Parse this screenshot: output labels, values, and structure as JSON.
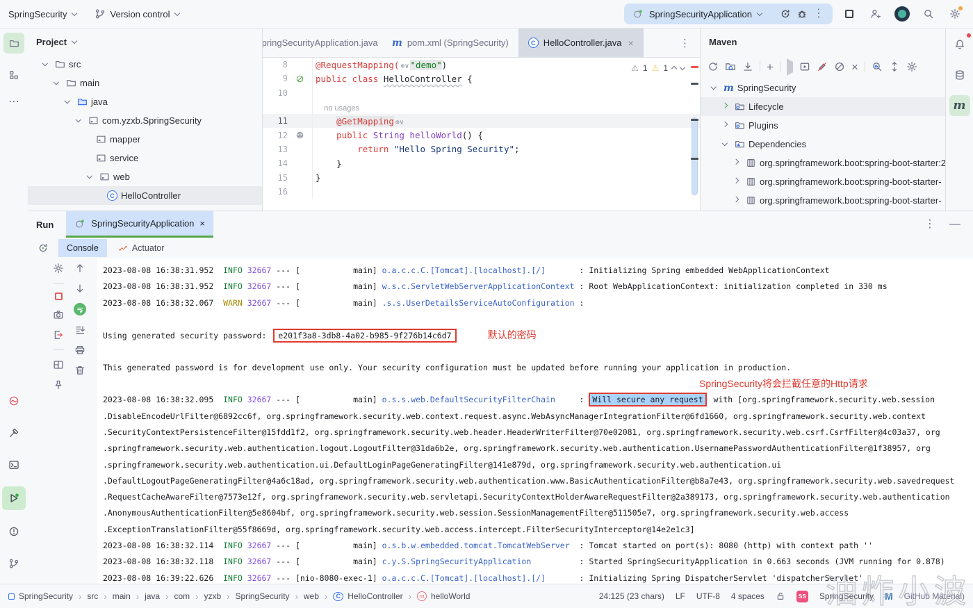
{
  "colors": {
    "accent_blue": "#3574f0",
    "run_green": "#57a64a",
    "selection_blue": "#cfe1fb",
    "annotation_red": "#e03b30",
    "info_green": "#168039",
    "warn_yellow": "#a68a00",
    "pid_purple": "#8250df",
    "logger_blue": "#3a63c8",
    "keyword_red": "#d5413e",
    "string_navy": "#17377a",
    "string_green": "#0b801a",
    "type_purple": "#8440c8",
    "active_tool_green": "#d5ebd8",
    "badge_pink": "#ee4f7d"
  },
  "topbar": {
    "project_name": "SpringSecurity",
    "version_control": "Version control",
    "run_config": "SpringSecurityApplication"
  },
  "project_panel": {
    "title": "Project",
    "tree": [
      {
        "label": "src",
        "depth": 0,
        "chev": "down",
        "icon": "folder-icon"
      },
      {
        "label": "main",
        "depth": 1,
        "chev": "down",
        "icon": "folder-icon"
      },
      {
        "label": "java",
        "depth": 2,
        "chev": "down",
        "icon": "folder-blue-icon"
      },
      {
        "label": "com.yzxb.SpringSecurity",
        "depth": 3,
        "chev": "down",
        "icon": "package-icon"
      },
      {
        "label": "mapper",
        "depth": 4,
        "chev": "none",
        "icon": "package-icon"
      },
      {
        "label": "service",
        "depth": 4,
        "chev": "none",
        "icon": "package-icon"
      },
      {
        "label": "web",
        "depth": 4,
        "chev": "down",
        "icon": "package-icon"
      },
      {
        "label": "HelloController",
        "depth": 5,
        "chev": "none",
        "icon": "class-icon",
        "selected": true
      }
    ]
  },
  "editor": {
    "tabs": [
      {
        "label": "SpringSecurityApplication.java",
        "icon": null,
        "clipped": true,
        "active": false
      },
      {
        "label": "pom.xml (SpringSecurity)",
        "icon": "maven-icon",
        "active": false
      },
      {
        "label": "HelloController.java",
        "icon": "class-icon",
        "active": true,
        "close": true
      }
    ],
    "inspections": {
      "errors": "1",
      "warnings": "1"
    },
    "inlay_hint": "no usages",
    "code": [
      {
        "num": "8",
        "tokens": [
          [
            "@RequestMapping(",
            "ann"
          ],
          [
            "INLAY"
          ],
          [
            "\"demo\"",
            "strg"
          ],
          [
            ")",
            "pln"
          ]
        ]
      },
      {
        "num": "9",
        "gutter": "run-class-icon",
        "tokens": [
          [
            "public class ",
            "kw"
          ],
          [
            "HelloController",
            "cls"
          ],
          [
            " {",
            "pln"
          ]
        ]
      },
      {
        "num": "10",
        "tokens": []
      },
      {
        "inlay": "no usages"
      },
      {
        "num": "11",
        "cur": true,
        "tokens": [
          [
            "    ",
            "pln"
          ],
          [
            "@GetMapping",
            "ann hl"
          ],
          [
            "INLAY"
          ]
        ]
      },
      {
        "num": "12",
        "gutter": "endpoint-icon",
        "tokens": [
          [
            "    ",
            "pln"
          ],
          [
            "public ",
            "kw"
          ],
          [
            "String ",
            "typ"
          ],
          [
            "helloWorld",
            "mtd"
          ],
          [
            "() {",
            "pln"
          ]
        ]
      },
      {
        "num": "13",
        "tokens": [
          [
            "        ",
            "pln"
          ],
          [
            "return ",
            "kw"
          ],
          [
            "\"Hello Spring Security\"",
            "str"
          ],
          [
            ";",
            "pln"
          ]
        ]
      },
      {
        "num": "14",
        "tokens": [
          [
            "    }",
            "pln"
          ]
        ]
      },
      {
        "num": "15",
        "tokens": [
          [
            "}",
            "pln"
          ]
        ]
      },
      {
        "num": "16",
        "tokens": []
      }
    ]
  },
  "maven": {
    "title": "Maven",
    "tree": [
      {
        "label": "SpringSecurity",
        "depth": 0,
        "chev": "down",
        "icon": "maven-icon"
      },
      {
        "label": "Lifecycle",
        "depth": 1,
        "chev": "right-green",
        "icon": "folder-gear-icon",
        "hover": true
      },
      {
        "label": "Plugins",
        "depth": 1,
        "chev": "right",
        "icon": "folder-gear-icon"
      },
      {
        "label": "Dependencies",
        "depth": 1,
        "chev": "down",
        "icon": "folder-lib-icon"
      },
      {
        "label": "org.springframework.boot:spring-boot-starter:2",
        "depth": 2,
        "chev": "right",
        "icon": "jar-icon"
      },
      {
        "label": "org.springframework.boot:spring-boot-starter-",
        "depth": 2,
        "chev": "right",
        "icon": "jar-icon"
      },
      {
        "label": "org.springframework.boot:spring-boot-starter-",
        "depth": 2,
        "chev": "right",
        "icon": "jar-icon"
      }
    ]
  },
  "run_panel": {
    "label": "Run",
    "tab": "SpringSecurityApplication",
    "tabs": [
      {
        "label": "Console",
        "selected": true
      },
      {
        "label": "Actuator",
        "selected": false
      }
    ],
    "console": [
      {
        "type": "log",
        "time": "2023-08-08 16:38:31.952",
        "level": "INFO",
        "pid": "32667",
        "thread": "main",
        "logger": "o.a.c.c.C.[Tomcat].[localhost].[/]",
        "msg": "Initializing Spring embedded WebApplicationContext"
      },
      {
        "type": "log",
        "time": "2023-08-08 16:38:31.952",
        "level": "INFO",
        "pid": "32667",
        "thread": "main",
        "logger": "w.s.c.ServletWebServerApplicationContext",
        "msg": "Root WebApplicationContext: initialization completed in 330 ms"
      },
      {
        "type": "log",
        "time": "2023-08-08 16:38:32.067",
        "level": "WARN",
        "pid": "32667",
        "thread": "main",
        "logger": ".s.s.UserDetailsServiceAutoConfiguration",
        "msg": ""
      },
      {
        "type": "blank"
      },
      {
        "type": "password",
        "prefix": "Using generated security password: ",
        "value": "e201f3a8-3db8-4a02-b985-9f276b14c6d7"
      },
      {
        "type": "blank"
      },
      {
        "type": "text",
        "text": "This generated password is for development use only. Your security configuration must be updated before running your application in production."
      },
      {
        "type": "annotation"
      },
      {
        "type": "secure",
        "time": "2023-08-08 16:38:32.095",
        "level": "INFO",
        "pid": "32667",
        "thread": "main",
        "logger": "o.s.s.web.DefaultSecurityFilterChain",
        "boxed": "Will secure any request",
        "after": " with [org.springframework.security.web.session"
      },
      {
        "type": "cont",
        "text": ".DisableEncodeUrlFilter@6892cc6f, org.springframework.security.web.context.request.async.WebAsyncManagerIntegrationFilter@6fd1660, org.springframework.security.web.context"
      },
      {
        "type": "cont",
        "text": ".SecurityContextPersistenceFilter@15fdd1f2, org.springframework.security.web.header.HeaderWriterFilter@70e02081, org.springframework.security.web.csrf.CsrfFilter@4c03a37, org"
      },
      {
        "type": "cont",
        "text": ".springframework.security.web.authentication.logout.LogoutFilter@31da6b2e, org.springframework.security.web.authentication.UsernamePasswordAuthenticationFilter@1f38957, org"
      },
      {
        "type": "cont",
        "text": ".springframework.security.web.authentication.ui.DefaultLoginPageGeneratingFilter@141e879d, org.springframework.security.web.authentication.ui"
      },
      {
        "type": "cont",
        "text": ".DefaultLogoutPageGeneratingFilter@4a6c18ad, org.springframework.security.web.authentication.www.BasicAuthenticationFilter@b8a7e43, org.springframework.security.web.savedrequest"
      },
      {
        "type": "cont",
        "text": ".RequestCacheAwareFilter@7573e12f, org.springframework.security.web.servletapi.SecurityContextHolderAwareRequestFilter@2a389173, org.springframework.security.web.authentication"
      },
      {
        "type": "cont",
        "text": ".AnonymousAuthenticationFilter@5e8604bf, org.springframework.security.web.session.SessionManagementFilter@511505e7, org.springframework.security.web.access"
      },
      {
        "type": "cont",
        "text": ".ExceptionTranslationFilter@55f8669d, org.springframework.security.web.access.intercept.FilterSecurityInterceptor@14e2e1c3]"
      },
      {
        "type": "log",
        "time": "2023-08-08 16:38:32.114",
        "level": "INFO",
        "pid": "32667",
        "thread": "main",
        "logger": "o.s.b.w.embedded.tomcat.TomcatWebServer",
        "msg": "Tomcat started on port(s): 8080 (http) with context path ''"
      },
      {
        "type": "log",
        "time": "2023-08-08 16:38:32.118",
        "level": "INFO",
        "pid": "32667",
        "thread": "main",
        "logger": "c.y.S.SpringSecurityApplication",
        "msg": "Started SpringSecurityApplication in 0.663 seconds (JVM running for 0.878)"
      },
      {
        "type": "log",
        "time": "2023-08-08 16:39:22.626",
        "level": "INFO",
        "pid": "32667",
        "thread": "nio-8080-exec-1",
        "logger": "o.a.c.c.C.[Tomcat].[localhost].[/]",
        "msg": "Initializing Spring DispatcherServlet 'dispatcherServlet'"
      }
    ]
  },
  "annotations": {
    "password_note": "默认的密码",
    "secure_note": "SpringSecurity将会拦截任意的Http请求"
  },
  "statusbar": {
    "breadcrumbs": [
      {
        "label": "SpringSecurity",
        "icon": "project-icon"
      },
      {
        "label": "src"
      },
      {
        "label": "main"
      },
      {
        "label": "java"
      },
      {
        "label": "com"
      },
      {
        "label": "yzxb"
      },
      {
        "label": "SpringSecurity"
      },
      {
        "label": "web"
      },
      {
        "label": "HelloController",
        "icon": "class-icon"
      },
      {
        "label": "helloWorld",
        "icon": "method-icon"
      }
    ],
    "right_items": [
      "24:125 (23 chars)",
      "LF",
      "UTF-8",
      "4 spaces"
    ],
    "badge": "SS",
    "project": "SpringSecurity",
    "theme": "GitHub Material)"
  },
  "watermark": "油炸小波",
  "glyphs": {
    "more_vertical": "⋮",
    "minimize": "—",
    "plus": "+",
    "close": "×",
    "overflow": "⋯",
    "warning": "⚠"
  }
}
